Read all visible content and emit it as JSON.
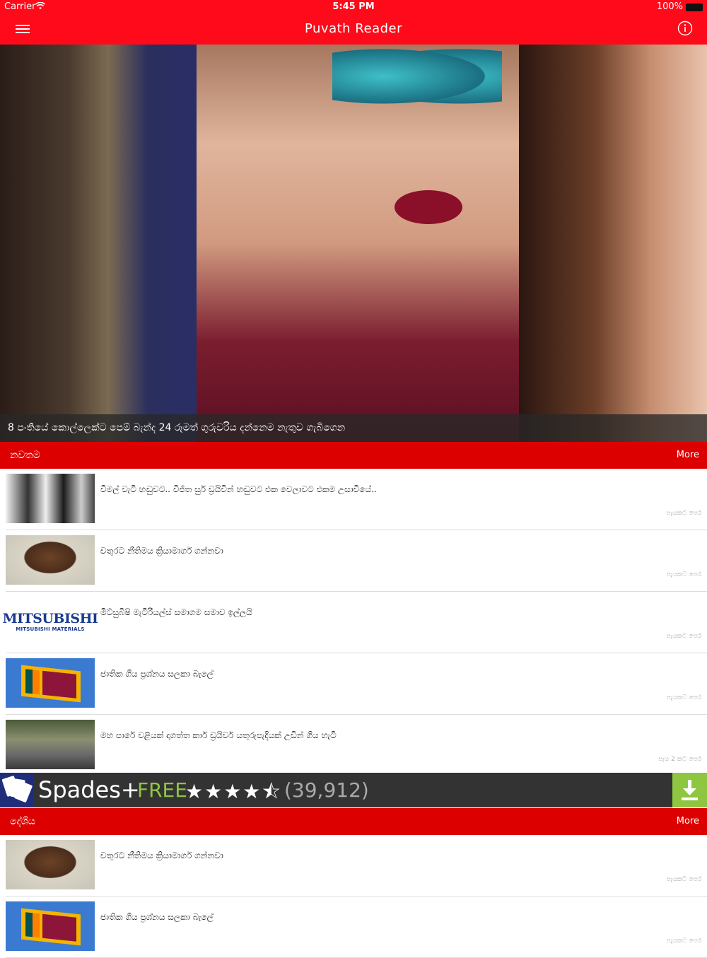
{
  "status_bar": {
    "carrier": "Carrier",
    "time": "5:45 PM",
    "battery": "100%"
  },
  "nav": {
    "title": "Puvath Reader"
  },
  "hero": {
    "caption": "8 පංතියේ කොල්ලෙක්ට පෙම් බැන්ද 24 රූමත් ගුරුවරිය දන්නෙම නැතුව ගැබිගෙන"
  },
  "section1": {
    "label": "නවතම",
    "more": "More",
    "items": [
      {
        "headline": "විමල් වැටී හඬුවට.. විජිත සුර් ඩ්‍රයිවින් හඬුවට එක වෙලාවට එකම උසාවියේ..",
        "time": "පැයකට පෙර",
        "thumb": "people"
      },
      {
        "headline": "චතුරට නීතිමය ක්‍රියාමාර්ග ගන්නවා",
        "time": "පැයකට පෙර",
        "thumb": "face"
      },
      {
        "headline": "මිට්සුබිෂි මැටීරියල්ස් සමාගම සමාව ඉල්ලයි",
        "time": "පැයකට පෙර",
        "thumb": "logo"
      },
      {
        "headline": "ජාතික ගීය ප්‍රශ්නය සලකා බැලේ",
        "time": "පැයකට පෙර",
        "thumb": "flag"
      },
      {
        "headline": "මහ පාරේ වළියක් දාගත්ත කාර් ඩ්‍රයිවර් යතුරුපැදියක් උඩින් ගිය හැටි",
        "time": "පැය 2 කට පෙර",
        "thumb": "street"
      }
    ]
  },
  "ad": {
    "name": "Spades+",
    "free": "FREE",
    "stars": "★★★★⯪",
    "count": "(39,912)"
  },
  "section2": {
    "label": "දේශීය",
    "more": "More",
    "items": [
      {
        "headline": "චතුරට නීතිමය ක්‍රියාමාර්ග ගන්නවා",
        "time": "පැයකට පෙර",
        "thumb": "face"
      },
      {
        "headline": "ජාතික ගීය ප්‍රශ්නය සලකා බැලේ",
        "time": "පැයකට පෙර",
        "thumb": "flag"
      }
    ]
  },
  "logo_thumb": {
    "brand": "MITSUBISHI",
    "sub": "MITSUBISHI MATERIALS"
  },
  "colors": {
    "primary": "#ff0a1a",
    "section": "#dc0000",
    "accent": "#8ec641"
  }
}
